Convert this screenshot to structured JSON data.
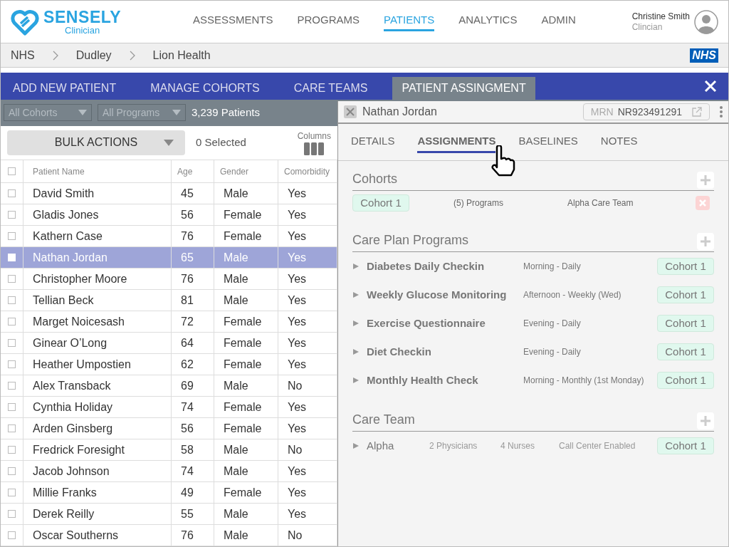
{
  "brand": {
    "name": "SENSELY",
    "subtitle": "Clinician"
  },
  "nav": [
    {
      "label": "ASSESSMENTS",
      "selected": false
    },
    {
      "label": "PROGRAMS",
      "selected": false
    },
    {
      "label": "PATIENTS",
      "selected": true
    },
    {
      "label": "ANALYTICS",
      "selected": false
    },
    {
      "label": "ADMIN",
      "selected": false
    }
  ],
  "user": {
    "name": "Christine Smith",
    "role": "Clincian"
  },
  "breadcrumb": [
    "NHS",
    "Dudley",
    "Lion Health"
  ],
  "nhs_logo": "NHS",
  "action_tabs": [
    {
      "label": "ADD NEW PATIENT",
      "selected": false
    },
    {
      "label": "MANAGE COHORTS",
      "selected": false
    },
    {
      "label": "CARE TEAMS",
      "selected": false
    },
    {
      "label": "PATIENT ASSINGMENT",
      "selected": true
    }
  ],
  "filters": {
    "cohorts": "All Cohorts",
    "programs": "All Programs",
    "count": "3,239 Patients"
  },
  "bulk": {
    "label": "BULK ACTIONS",
    "selected_count": "0 Selected",
    "columns_label": "Columns"
  },
  "table": {
    "select_all_checked": false,
    "columns": [
      "Patient Name",
      "Age",
      "Gender",
      "Comorbidity"
    ],
    "rows": [
      {
        "cells": [
          "David Smith",
          "45",
          "Male",
          "Yes"
        ],
        "selected": false
      },
      {
        "cells": [
          "Gladis Jones",
          "56",
          "Female",
          "Yes"
        ],
        "selected": false
      },
      {
        "cells": [
          "Kathern Case",
          "76",
          "Female",
          "Yes"
        ],
        "selected": false
      },
      {
        "cells": [
          "Nathan Jordan",
          "65",
          "Male",
          "Yes"
        ],
        "selected": true
      },
      {
        "cells": [
          "Christopher Moore",
          "76",
          "Male",
          "Yes"
        ],
        "selected": false
      },
      {
        "cells": [
          "Tellian Beck",
          "81",
          "Male",
          "Yes"
        ],
        "selected": false
      },
      {
        "cells": [
          "Marget Noicesash",
          "72",
          "Female",
          "Yes"
        ],
        "selected": false
      },
      {
        "cells": [
          "Ginear O’Long",
          "64",
          "Female",
          "Yes"
        ],
        "selected": false
      },
      {
        "cells": [
          "Heather Umpostien",
          "62",
          "Female",
          "Yes"
        ],
        "selected": false
      },
      {
        "cells": [
          "Alex Transback",
          "69",
          "Male",
          "No"
        ],
        "selected": false
      },
      {
        "cells": [
          "Cynthia Holiday",
          "74",
          "Female",
          "Yes"
        ],
        "selected": false
      },
      {
        "cells": [
          "Arden Ginsberg",
          "56",
          "Female",
          "Yes"
        ],
        "selected": false
      },
      {
        "cells": [
          "Fredrick Foresight",
          "58",
          "Male",
          "No"
        ],
        "selected": false
      },
      {
        "cells": [
          "Jacob Johnson",
          "74",
          "Male",
          "Yes"
        ],
        "selected": false
      },
      {
        "cells": [
          "Millie Franks",
          "49",
          "Female",
          "Yes"
        ],
        "selected": false
      },
      {
        "cells": [
          "Derek Reilly",
          "55",
          "Male",
          "Yes"
        ],
        "selected": false
      },
      {
        "cells": [
          "Oscar Southerns",
          "76",
          "Male",
          "No"
        ],
        "selected": false
      }
    ]
  },
  "panel": {
    "patient": "Nathan Jordan",
    "mrn_label": "MRN",
    "mrn": "NR923491291",
    "tabs": [
      {
        "label": "DETAILS",
        "selected": false
      },
      {
        "label": "ASSIGNMENTS",
        "selected": true
      },
      {
        "label": "BASELINES",
        "selected": false
      },
      {
        "label": "NOTES",
        "selected": false
      }
    ],
    "cohorts": {
      "title": "Cohorts",
      "items": [
        {
          "tag": "Cohort 1",
          "programs": "(5) Programs",
          "team": "Alpha Care Team"
        }
      ]
    },
    "programs": {
      "title": "Care Plan Programs",
      "items": [
        {
          "name": "Diabetes Daily Checkin",
          "schedule": "Morning - Daily",
          "tag": "Cohort 1"
        },
        {
          "name": "Weekly Glucose Monitoring",
          "schedule": "Afternoon - Weekly (Wed)",
          "tag": "Cohort 1"
        },
        {
          "name": "Exercise Questionnaire",
          "schedule": "Evening - Daily",
          "tag": "Cohort 1"
        },
        {
          "name": "Diet Checkin",
          "schedule": "Evening - Daily",
          "tag": "Cohort 1"
        },
        {
          "name": "Monthly Health Check",
          "schedule": "Morning - Monthly (1st Monday)",
          "tag": "Cohort 1"
        }
      ]
    },
    "care_team": {
      "title": "Care Team",
      "items": [
        {
          "name": "Alpha",
          "physicians": "2 Physicians",
          "nurses": "4 Nurses",
          "call_center": "Call Center Enabled",
          "tag": "Cohort 1"
        }
      ]
    }
  }
}
